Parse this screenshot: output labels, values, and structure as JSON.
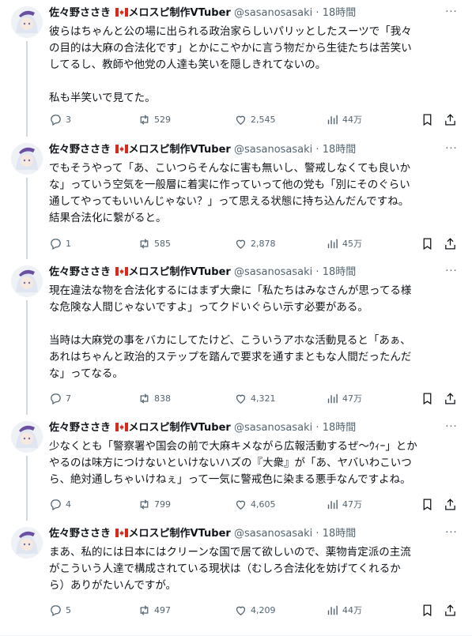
{
  "author": {
    "display_name_prefix": "佐々野ささき",
    "display_name_suffix": "メロスピ制作VTuber",
    "handle": "@sasanosasaki",
    "separator": "·",
    "flag_icon": "canada-flag-icon"
  },
  "tweets": [
    {
      "time": "18時間",
      "text": "彼らはちゃんと公の場に出られる政治家らしいパリッとしたスーツで「我々\nの目的は大麻の合法化です」とかにこやかに言う物だから生徒たちは苦笑い\nしてるし、教師や他党の人達も笑いを隠しきれてないの。\n\n私も半笑いで見てた。",
      "replies": "3",
      "retweets": "529",
      "likes": "2,545",
      "views": "44万"
    },
    {
      "time": "18時間",
      "text": "でもそうやって「あ、こいつらそんなに害も無いし、警戒しなくても良いか\nな」っていう空気を一般層に着実に作っていって他の党も「別にそのぐらい\n通してやってもいいんじゃない？」って思える状態に持ち込んだんですね。\n結果合法化に繋がると。",
      "replies": "1",
      "retweets": "585",
      "likes": "2,878",
      "views": "45万"
    },
    {
      "time": "18時間",
      "text": "現在違法な物を合法化するにはまず大衆に「私たちはみなさんが思ってる様\nな危険な人間じゃないですよ」ってクドいぐらい示す必要がある。\n\n当時は大麻党の事をバカにしてたけど、こういうアホな活動見ると「あぁ、\nあれはちゃんと政治的ステップを踏んで要求を通すまともな人間だったんだ\nな」ってなる。",
      "replies": "7",
      "retweets": "838",
      "likes": "4,321",
      "views": "47万"
    },
    {
      "time": "18時間",
      "text": "少なくとも「警察署や国会の前で大麻キメながら広報活動するぜ〜ｳｨｰ」とか\nやるのは味方につけないといけないハズの『大衆』が「あ、ヤバいわこいつ\nら、絶対通しちゃいけねぇ」って一気に警戒色に染まる悪手なんですよね。",
      "replies": "4",
      "retweets": "799",
      "likes": "4,605",
      "views": "47万"
    },
    {
      "time": "18時間",
      "text": "まあ、私的には日本にはクリーンな国で居て欲しいので、薬物肯定派の主流\nがこういう人達で構成されている現状は（むしろ合法化を妨げてくれるか\nら）ありがたいんですが。",
      "replies": "5",
      "retweets": "497",
      "likes": "4,209",
      "views": "44万"
    }
  ],
  "icons": {
    "reply": "reply-icon",
    "retweet": "retweet-icon",
    "like": "heart-icon",
    "views": "views-chart-icon",
    "bookmark": "bookmark-icon",
    "share": "share-icon",
    "more": "more-icon"
  },
  "colors": {
    "text": "#0f1419",
    "secondary": "#536471",
    "thread_line": "#cfd9de",
    "avatar_hair": "#dfe6f2",
    "avatar_hat": "#6b4fa0",
    "flag_red": "#d52b1e"
  }
}
